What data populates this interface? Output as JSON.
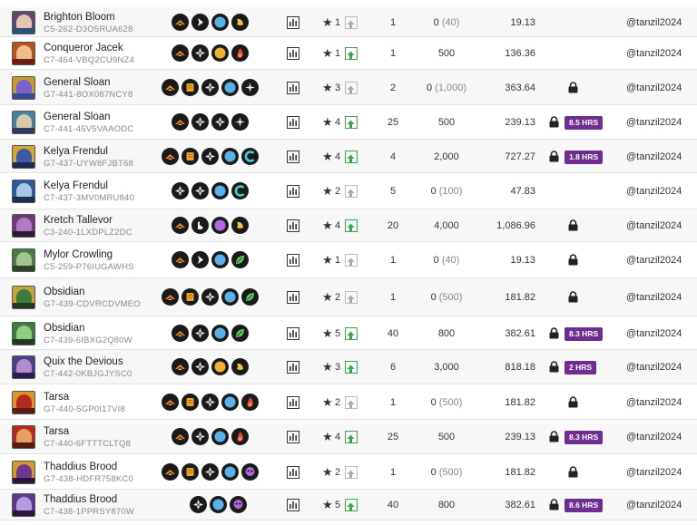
{
  "header": {
    "partial_text": "...g "
  },
  "rows": [
    {
      "name": "Brighton Bloom",
      "uid": "C5-262-D3O5RUA628",
      "abilities": [
        "flame-chevron",
        "arrow-right",
        "blue-circle",
        "yellow-dodge"
      ],
      "level": "1",
      "level_up": false,
      "xp": "1",
      "burn": "0",
      "burn_paren": "(40)",
      "price": "19.13",
      "locked": false,
      "badge": "",
      "owner": "@tanzil2024",
      "colors": [
        "#5d4a6e",
        "#e8c3b2",
        "#2a4f79"
      ]
    },
    {
      "name": "Conqueror Jacek",
      "uid": "C7-464-VBQ2CU9NZ4",
      "abilities": [
        "flame-chevron",
        "diamond-cross",
        "orange-circle",
        "red-flame"
      ],
      "level": "1",
      "level_up": true,
      "xp": "1",
      "burn": "500",
      "burn_paren": "",
      "price": "136.36",
      "locked": false,
      "badge": "",
      "owner": "@tanzil2024",
      "colors": [
        "#b3531f",
        "#f0bd8d",
        "#6a2010"
      ]
    },
    {
      "name": "General Sloan",
      "uid": "G7-441-8OX087NCY8",
      "abilities": [
        "flame-chevron",
        "orange-scroll",
        "diamond-cross",
        "blue-circle",
        "white-star"
      ],
      "level": "3",
      "level_up": false,
      "xp": "2",
      "burn": "0",
      "burn_paren": "(1,000)",
      "price": "363.64",
      "locked": true,
      "badge": "",
      "owner": "@tanzil2024",
      "colors": [
        "#c79a2c",
        "#7c5ecf",
        "#374a97"
      ]
    },
    {
      "name": "General Sloan",
      "uid": "C7-441-45V5VAAODC",
      "abilities": [
        "flame-chevron",
        "diamond-cross",
        "diamond-cross",
        "white-star"
      ],
      "level": "4",
      "level_up": true,
      "xp": "25",
      "burn": "500",
      "burn_paren": "",
      "price": "239.13",
      "locked": true,
      "badge": "8.5 HRS",
      "owner": "@tanzil2024",
      "colors": [
        "#4b7fa2",
        "#d8caa8",
        "#2d3c5d"
      ]
    },
    {
      "name": "Kelya Frendul",
      "uid": "G7-437-UYW8FJBT68",
      "abilities": [
        "flame-chevron",
        "orange-scroll",
        "diamond-cross",
        "blue-circle",
        "cyan-arc"
      ],
      "level": "4",
      "level_up": true,
      "xp": "4",
      "burn": "2,000",
      "burn_paren": "",
      "price": "727.27",
      "locked": true,
      "badge": "1.8 HRS",
      "owner": "@tanzil2024",
      "colors": [
        "#d6a53a",
        "#3b5aa8",
        "#1b2a54"
      ]
    },
    {
      "name": "Kelya Frendul",
      "uid": "C7-437-3MV0MRU840",
      "abilities": [
        "diamond-cross",
        "diamond-cross",
        "blue-circle",
        "cyan-arc"
      ],
      "level": "2",
      "level_up": false,
      "xp": "5",
      "burn": "0",
      "burn_paren": "(100)",
      "price": "47.83",
      "locked": false,
      "badge": "",
      "owner": "@tanzil2024",
      "colors": [
        "#2d5c99",
        "#a7c8e5",
        "#1a2d50"
      ]
    },
    {
      "name": "Kretch Tallevor",
      "uid": "C3-240-1LXDPLZ2DC",
      "abilities": [
        "flame-chevron",
        "white-hand",
        "purple-circle",
        "yellow-dodge"
      ],
      "level": "4",
      "level_up": true,
      "xp": "20",
      "burn": "4,000",
      "burn_paren": "",
      "price": "1,086.96",
      "locked": true,
      "badge": "",
      "owner": "@tanzil2024",
      "colors": [
        "#6e3a75",
        "#b27ac0",
        "#2a1731"
      ]
    },
    {
      "name": "Mylor Crowling",
      "uid": "C5-259-P76IUGAWHS",
      "abilities": [
        "flame-chevron",
        "arrow-right",
        "blue-circle",
        "green-leaf"
      ],
      "level": "1",
      "level_up": false,
      "xp": "1",
      "burn": "0",
      "burn_paren": "(40)",
      "price": "19.13",
      "locked": true,
      "badge": "",
      "owner": "@tanzil2024",
      "colors": [
        "#4a7a46",
        "#a1c58a",
        "#2b4429"
      ]
    },
    {
      "name": "Obsidian",
      "uid": "G7-439-CDVRCDVMEO",
      "abilities": [
        "flame-chevron",
        "orange-scroll",
        "diamond-cross",
        "blue-circle",
        "green-leaf"
      ],
      "level": "2",
      "level_up": false,
      "xp": "1",
      "burn": "0",
      "burn_paren": "(500)",
      "price": "181.82",
      "locked": true,
      "badge": "",
      "owner": "@tanzil2024",
      "colors": [
        "#c8a23a",
        "#3f7a3e",
        "#1f3a1e"
      ]
    },
    {
      "name": "Obsidian",
      "uid": "C7-439-6IBXG2Q80W",
      "abilities": [
        "flame-chevron",
        "diamond-cross",
        "blue-circle",
        "green-leaf"
      ],
      "level": "5",
      "level_up": true,
      "xp": "40",
      "burn": "800",
      "burn_paren": "",
      "price": "382.61",
      "locked": true,
      "badge": "8.3 HRS",
      "owner": "@tanzil2024",
      "colors": [
        "#3f7a3e",
        "#8ecf7c",
        "#1f3a1e"
      ]
    },
    {
      "name": "Quix the Devious",
      "uid": "C7-442-0KBJGJYSC0",
      "abilities": [
        "flame-chevron",
        "diamond-cross",
        "orange-circle",
        "yellow-dodge"
      ],
      "level": "3",
      "level_up": true,
      "xp": "6",
      "burn": "3,000",
      "burn_paren": "",
      "price": "818.18",
      "locked": true,
      "badge": "2 HRS",
      "owner": "@tanzil2024",
      "colors": [
        "#4b3f8a",
        "#b58bd0",
        "#26204a"
      ]
    },
    {
      "name": "Tarsa",
      "uid": "G7-440-5GP0I17VI8",
      "abilities": [
        "flame-chevron",
        "orange-scroll",
        "diamond-cross",
        "blue-circle",
        "red-flame"
      ],
      "level": "2",
      "level_up": false,
      "xp": "1",
      "burn": "0",
      "burn_paren": "(500)",
      "price": "181.82",
      "locked": true,
      "badge": "",
      "owner": "@tanzil2024",
      "colors": [
        "#d7972c",
        "#b32b1e",
        "#5a1a10"
      ]
    },
    {
      "name": "Tarsa",
      "uid": "C7-440-6FTTTCLTQ8",
      "abilities": [
        "flame-chevron",
        "diamond-cross",
        "blue-circle",
        "red-flame"
      ],
      "level": "4",
      "level_up": true,
      "xp": "25",
      "burn": "500",
      "burn_paren": "",
      "price": "239.13",
      "locked": true,
      "badge": "8.3 HRS",
      "owner": "@tanzil2024",
      "colors": [
        "#b32b1e",
        "#e8a15d",
        "#5a1a10"
      ]
    },
    {
      "name": "Thaddius Brood",
      "uid": "G7-438-HDFR758KC0",
      "abilities": [
        "flame-chevron",
        "orange-scroll",
        "diamond-cross",
        "blue-circle",
        "purple-skull"
      ],
      "level": "2",
      "level_up": false,
      "xp": "1",
      "burn": "0",
      "burn_paren": "(500)",
      "price": "181.82",
      "locked": true,
      "badge": "",
      "owner": "@tanzil2024",
      "colors": [
        "#d29a2d",
        "#6b3a8e",
        "#2a1740"
      ]
    },
    {
      "name": "Thaddius Brood",
      "uid": "C7-438-1PPRSY870W",
      "abilities": [
        "diamond-cross",
        "blue-circle",
        "purple-skull"
      ],
      "level": "5",
      "level_up": true,
      "xp": "40",
      "burn": "800",
      "burn_paren": "",
      "price": "382.61",
      "locked": true,
      "badge": "8.6 HRS",
      "owner": "@tanzil2024",
      "colors": [
        "#5b3a8e",
        "#b79be0",
        "#2a1740"
      ]
    }
  ]
}
